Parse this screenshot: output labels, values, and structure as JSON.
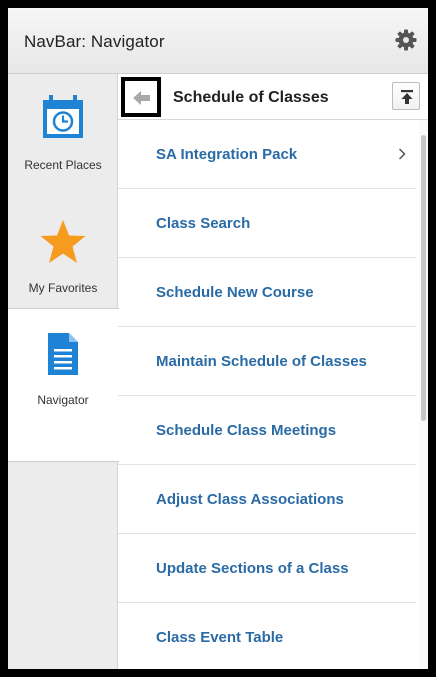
{
  "window": {
    "title": "NavBar: Navigator"
  },
  "sidebar": {
    "items": [
      {
        "label": "Recent Places",
        "icon": "calendar-clock-icon"
      },
      {
        "label": "My Favorites",
        "icon": "star-icon"
      },
      {
        "label": "Navigator",
        "icon": "document-icon"
      }
    ]
  },
  "panel": {
    "title": "Schedule of Classes",
    "items": [
      {
        "label": "SA Integration Pack",
        "has_children": true
      },
      {
        "label": "Class Search"
      },
      {
        "label": "Schedule New Course"
      },
      {
        "label": "Maintain Schedule of Classes"
      },
      {
        "label": "Schedule Class Meetings"
      },
      {
        "label": "Adjust Class Associations"
      },
      {
        "label": "Update Sections of a Class"
      },
      {
        "label": "Class Event Table"
      }
    ]
  },
  "colors": {
    "link": "#2a6ba6",
    "icon_blue": "#1e83d4",
    "star_orange": "#f59b1e"
  }
}
